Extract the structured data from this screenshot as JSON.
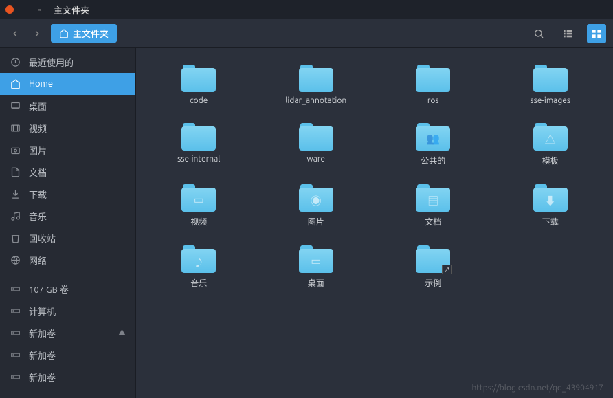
{
  "window": {
    "title": "主文件夹"
  },
  "toolbar": {
    "path_label": "主文件夹"
  },
  "sidebar": {
    "items": [
      {
        "label": "最近使用的",
        "icon": "clock"
      },
      {
        "label": "Home",
        "icon": "home",
        "active": true
      },
      {
        "label": "桌面",
        "icon": "desktop"
      },
      {
        "label": "视频",
        "icon": "video"
      },
      {
        "label": "图片",
        "icon": "camera"
      },
      {
        "label": "文档",
        "icon": "document"
      },
      {
        "label": "下载",
        "icon": "download"
      },
      {
        "label": "音乐",
        "icon": "music"
      },
      {
        "label": "回收站",
        "icon": "trash"
      },
      {
        "label": "网络",
        "icon": "network"
      }
    ],
    "devices": [
      {
        "label": "107 GB 卷",
        "icon": "disk"
      },
      {
        "label": "计算机",
        "icon": "disk"
      },
      {
        "label": "新加卷",
        "icon": "disk",
        "eject": true
      },
      {
        "label": "新加卷",
        "icon": "disk"
      },
      {
        "label": "新加卷",
        "icon": "disk"
      }
    ]
  },
  "folders": [
    {
      "label": "code",
      "glyph": ""
    },
    {
      "label": "lidar_annotation",
      "glyph": ""
    },
    {
      "label": "ros",
      "glyph": ""
    },
    {
      "label": "sse-images",
      "glyph": ""
    },
    {
      "label": "sse-internal",
      "glyph": ""
    },
    {
      "label": "ware",
      "glyph": ""
    },
    {
      "label": "公共的",
      "glyph": "👥"
    },
    {
      "label": "模板",
      "glyph": "△"
    },
    {
      "label": "视频",
      "glyph": "▭"
    },
    {
      "label": "图片",
      "glyph": "◉"
    },
    {
      "label": "文档",
      "glyph": "▤"
    },
    {
      "label": "下载",
      "glyph": "⬇"
    },
    {
      "label": "音乐",
      "glyph": "♪"
    },
    {
      "label": "桌面",
      "glyph": "▭"
    },
    {
      "label": "示例",
      "glyph": "",
      "shortcut": true
    }
  ],
  "watermark": "https://blog.csdn.net/qq_43904917"
}
